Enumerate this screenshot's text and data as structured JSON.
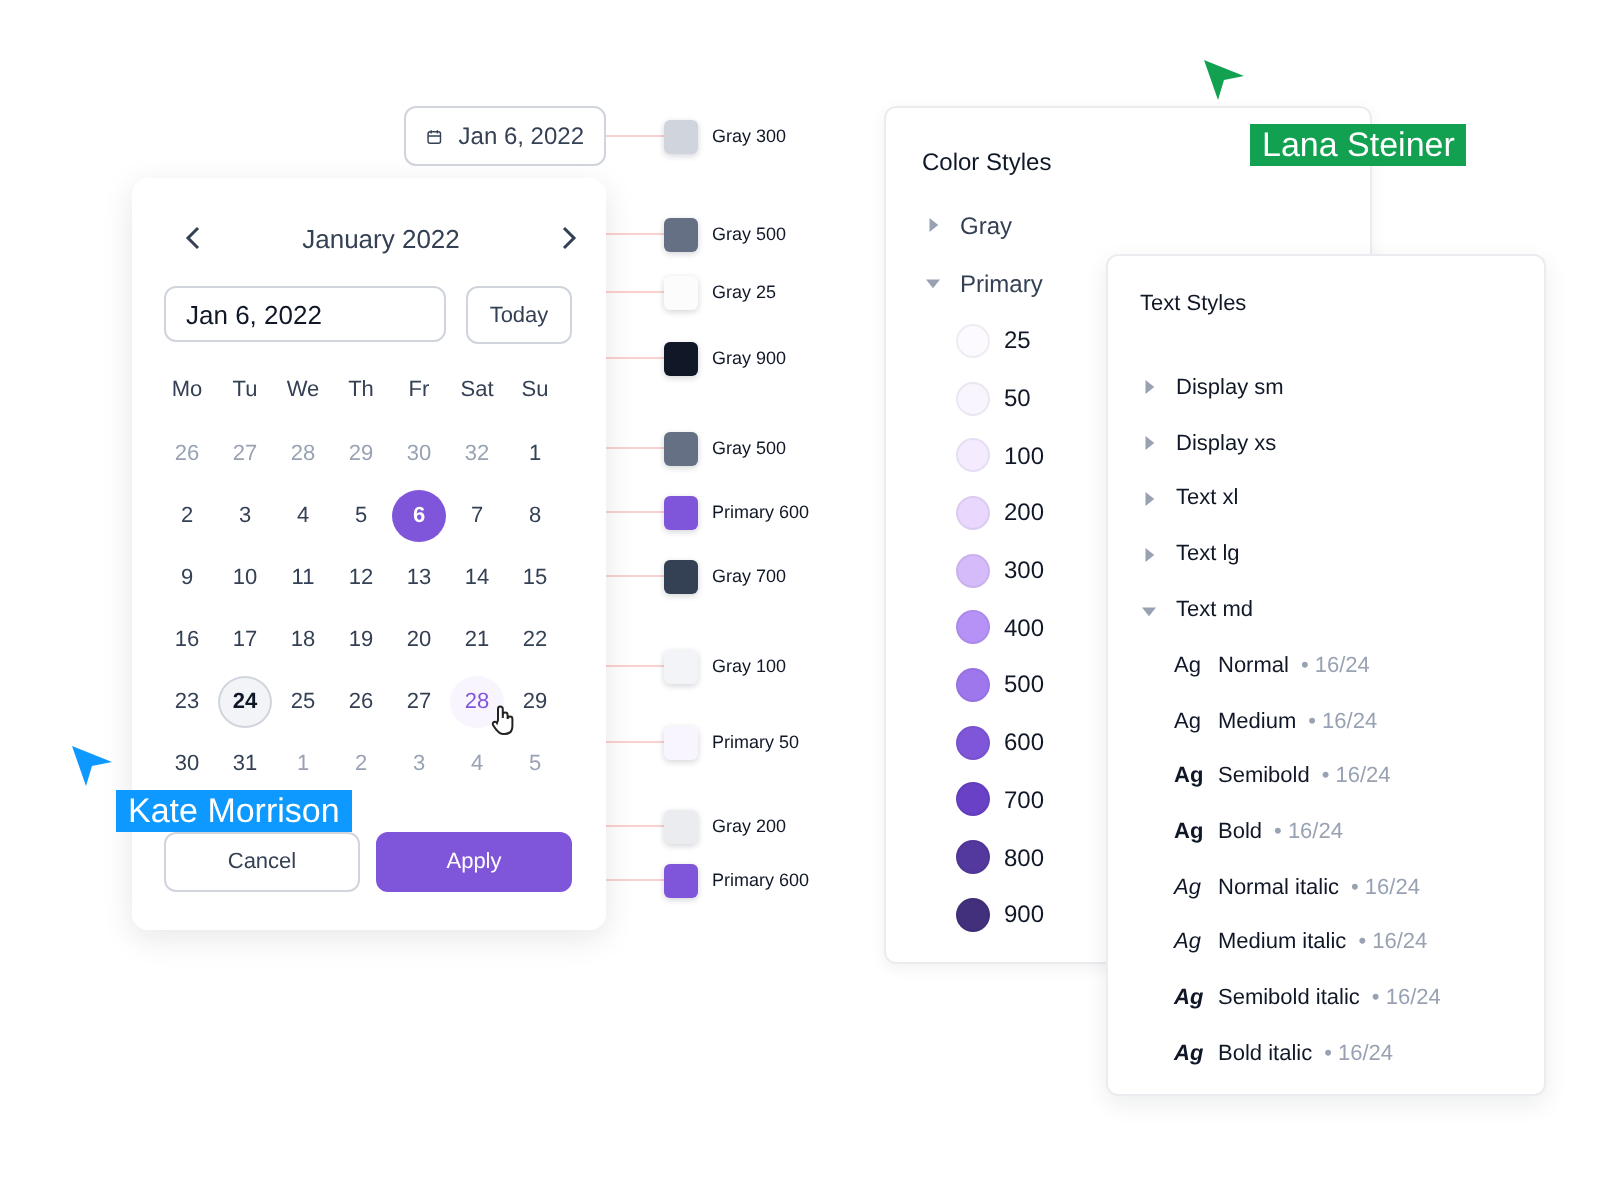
{
  "date_button": {
    "text": "Jan 6, 2022"
  },
  "calendar": {
    "month": "January 2022",
    "input_value": "Jan 6, 2022",
    "today_button": "Today",
    "weekdays": [
      "Mo",
      "Tu",
      "We",
      "Th",
      "Fr",
      "Sat",
      "Su"
    ],
    "weeks": [
      [
        {
          "label": "26",
          "kind": "muted"
        },
        {
          "label": "27",
          "kind": "muted"
        },
        {
          "label": "28",
          "kind": "muted"
        },
        {
          "label": "29",
          "kind": "muted"
        },
        {
          "label": "30",
          "kind": "muted"
        },
        {
          "label": "32",
          "kind": "muted"
        },
        {
          "label": "1",
          "kind": "normal"
        }
      ],
      [
        {
          "label": "2",
          "kind": "normal"
        },
        {
          "label": "3",
          "kind": "normal"
        },
        {
          "label": "4",
          "kind": "normal"
        },
        {
          "label": "5",
          "kind": "normal"
        },
        {
          "label": "6",
          "kind": "selected"
        },
        {
          "label": "7",
          "kind": "normal"
        },
        {
          "label": "8",
          "kind": "normal"
        }
      ],
      [
        {
          "label": "9",
          "kind": "normal"
        },
        {
          "label": "10",
          "kind": "normal"
        },
        {
          "label": "11",
          "kind": "normal"
        },
        {
          "label": "12",
          "kind": "normal"
        },
        {
          "label": "13",
          "kind": "normal"
        },
        {
          "label": "14",
          "kind": "normal"
        },
        {
          "label": "15",
          "kind": "normal"
        }
      ],
      [
        {
          "label": "16",
          "kind": "normal"
        },
        {
          "label": "17",
          "kind": "normal"
        },
        {
          "label": "18",
          "kind": "normal"
        },
        {
          "label": "19",
          "kind": "normal"
        },
        {
          "label": "20",
          "kind": "normal"
        },
        {
          "label": "21",
          "kind": "normal"
        },
        {
          "label": "22",
          "kind": "normal"
        }
      ],
      [
        {
          "label": "23",
          "kind": "normal"
        },
        {
          "label": "24",
          "kind": "today"
        },
        {
          "label": "25",
          "kind": "normal"
        },
        {
          "label": "26",
          "kind": "normal"
        },
        {
          "label": "27",
          "kind": "normal"
        },
        {
          "label": "28",
          "kind": "hover"
        },
        {
          "label": "29",
          "kind": "normal"
        }
      ],
      [
        {
          "label": "30",
          "kind": "normal"
        },
        {
          "label": "31",
          "kind": "normal"
        },
        {
          "label": "1",
          "kind": "muted"
        },
        {
          "label": "2",
          "kind": "muted"
        },
        {
          "label": "3",
          "kind": "muted"
        },
        {
          "label": "4",
          "kind": "muted"
        },
        {
          "label": "5",
          "kind": "muted"
        }
      ]
    ],
    "buttons": [
      {
        "label": "Cancel",
        "kind": "secondary"
      },
      {
        "label": "Apply",
        "kind": "primary"
      }
    ]
  },
  "swatches": [
    {
      "label": "Gray 300",
      "color": "#d0d5dd"
    },
    {
      "label": "Gray 500",
      "color": "#667085"
    },
    {
      "label": "Gray 25",
      "color": "#fcfcfd"
    },
    {
      "label": "Gray 900",
      "color": "#101828"
    },
    {
      "label": "Gray 500",
      "color": "#667085"
    },
    {
      "label": "Primary 600",
      "color": "#7f56d9"
    },
    {
      "label": "Gray 700",
      "color": "#344054"
    },
    {
      "label": "Gray 100",
      "color": "#f2f4f7"
    },
    {
      "label": "Primary 50",
      "color": "#f9f5ff"
    },
    {
      "label": "Gray 200",
      "color": "#eaecf0"
    },
    {
      "label": "Primary 600",
      "color": "#7f56d9"
    }
  ],
  "color_styles": {
    "title": "Color Styles",
    "groups": [
      {
        "label": "Gray",
        "expanded": false
      },
      {
        "label": "Primary",
        "expanded": true,
        "shades": [
          {
            "label": "25",
            "color": "#fcfaff"
          },
          {
            "label": "50",
            "color": "#f9f5ff"
          },
          {
            "label": "100",
            "color": "#f4ebff"
          },
          {
            "label": "200",
            "color": "#e9d7fe"
          },
          {
            "label": "300",
            "color": "#d6bbfb"
          },
          {
            "label": "400",
            "color": "#b692f6"
          },
          {
            "label": "500",
            "color": "#9e77ed"
          },
          {
            "label": "600",
            "color": "#7f56d9"
          },
          {
            "label": "700",
            "color": "#6941c6"
          },
          {
            "label": "800",
            "color": "#53389e"
          },
          {
            "label": "900",
            "color": "#42307d"
          }
        ]
      }
    ]
  },
  "text_styles": {
    "title": "Text Styles",
    "items": [
      {
        "label": "Display sm",
        "expanded": false
      },
      {
        "label": "Display xs",
        "expanded": false
      },
      {
        "label": "Text xl",
        "expanded": false
      },
      {
        "label": "Text lg",
        "expanded": false
      },
      {
        "label": "Text md",
        "expanded": true,
        "children": [
          {
            "sample": "Ag",
            "name": "Normal",
            "spec": "• 16/24",
            "kind": "normal",
            "italic": false
          },
          {
            "sample": "Ag",
            "name": "Medium",
            "spec": "• 16/24",
            "kind": "medium",
            "italic": false
          },
          {
            "sample": "Ag",
            "name": "Semibold",
            "spec": "• 16/24",
            "kind": "semibold",
            "italic": false
          },
          {
            "sample": "Ag",
            "name": "Bold",
            "spec": "• 16/24",
            "kind": "bold",
            "italic": false
          },
          {
            "sample": "Ag",
            "name": "Normal italic",
            "spec": "• 16/24",
            "kind": "normal",
            "italic": true
          },
          {
            "sample": "Ag",
            "name": "Medium italic",
            "spec": "• 16/24",
            "kind": "medium",
            "italic": true
          },
          {
            "sample": "Ag",
            "name": "Semibold italic",
            "spec": "• 16/24",
            "kind": "semibold",
            "italic": true
          },
          {
            "sample": "Ag",
            "name": "Bold italic",
            "spec": "• 16/24",
            "kind": "bold",
            "italic": true
          }
        ]
      }
    ]
  },
  "cursors": [
    {
      "name": "Lana Steiner",
      "color": "#12a150"
    },
    {
      "name": "Kate Morrison",
      "color": "#0d99ff"
    }
  ]
}
